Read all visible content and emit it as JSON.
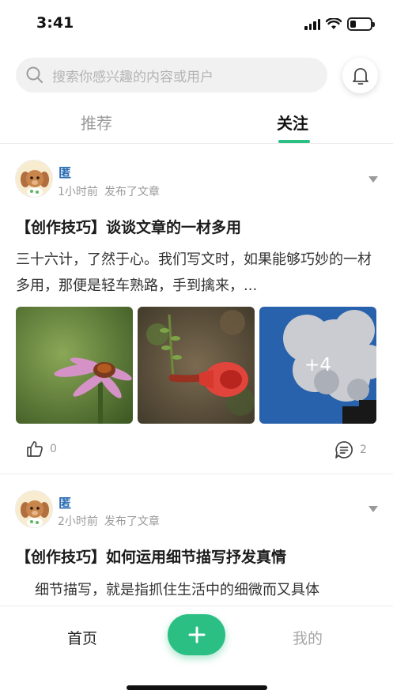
{
  "status_bar": {
    "time": "3:41"
  },
  "header": {
    "search_placeholder": "搜索你感兴趣的内容或用户",
    "search_icon": "search-icon",
    "bell_icon": "bell-icon"
  },
  "tabs": [
    {
      "label": "推荐",
      "active": false
    },
    {
      "label": "关注",
      "active": true
    }
  ],
  "posts": [
    {
      "author": "匿",
      "time": "1小时前",
      "action": "发布了文章",
      "title": "【创作技巧】谈谈文章的一材多用",
      "excerpt": "三十六计，了然于心。我们写文时，如果能够巧妙的一材多用，那便是轻车熟路，手到擒来，...",
      "images": [
        "flower-image",
        "red-flower-image",
        "cloud-sky-image"
      ],
      "more_images_label": "+4",
      "likes": "0",
      "comments": "2"
    },
    {
      "author": "匿",
      "time": "2小时前",
      "action": "发布了文章",
      "title": "【创作技巧】如何运用细节描写抒发真情",
      "excerpt": "细节描写，就是指抓住生活中的细微而又具体"
    }
  ],
  "bottom_nav": {
    "home": "首页",
    "add": "+",
    "mine": "我的"
  },
  "colors": {
    "accent": "#2bbf84",
    "author": "#2f6fb5"
  }
}
